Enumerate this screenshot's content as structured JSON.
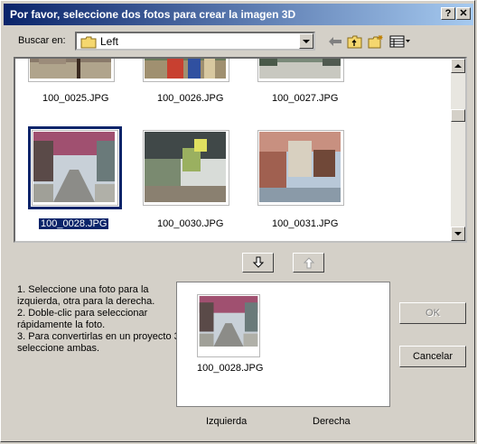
{
  "window": {
    "title": "Por favor, seleccione dos fotos para crear la imagen 3D"
  },
  "titlebar_buttons": {
    "help": "?",
    "close": "✕"
  },
  "lookin": {
    "label": "Buscar en:",
    "value": "Left"
  },
  "files": [
    {
      "name": "100_0025.JPG"
    },
    {
      "name": "100_0026.JPG"
    },
    {
      "name": "100_0027.JPG"
    },
    {
      "name": "100_0028.JPG",
      "selected": true
    },
    {
      "name": "100_0030.JPG"
    },
    {
      "name": "100_0031.JPG"
    }
  ],
  "transfer": {
    "down_icon": "arrow-down",
    "up_icon": "arrow-up"
  },
  "instructions": [
    "1. Seleccione una foto para la izquierda, otra para la derecha.",
    "2. Doble-clic para seleccionar rápidamente la foto.",
    "3. Para convertirlas en un proyecto 3D seleccione ambas."
  ],
  "preview": {
    "selected_file": "100_0028.JPG"
  },
  "slots": {
    "left_label": "Izquierda",
    "right_label": "Derecha"
  },
  "buttons": {
    "ok": "OK",
    "cancel": "Cancelar"
  },
  "colors": {
    "titlebar_start": "#0a246a",
    "titlebar_end": "#a6caf0",
    "dialog_bg": "#d4d0c8",
    "selection": "#0a246a"
  }
}
